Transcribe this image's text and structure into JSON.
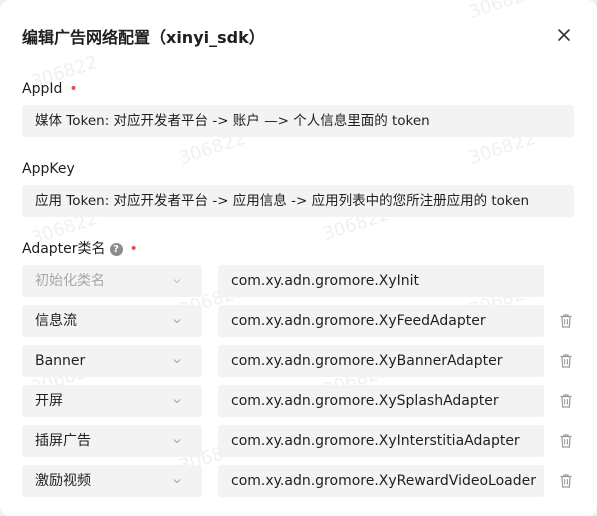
{
  "dialog": {
    "title": "编辑广告网络配置（xinyi_sdk）"
  },
  "fields": {
    "appid": {
      "label": "AppId",
      "required_mark": "•",
      "value": "媒体 Token: 对应开发者平台 -> 账户 —> 个人信息里面的 token"
    },
    "appkey": {
      "label": "AppKey",
      "value": "应用 Token: 对应开发者平台 -> 应用信息 -> 应用列表中的您所注册应用的 token"
    },
    "adapter": {
      "label": "Adapter类名",
      "help_glyph": "?",
      "required_mark": "•",
      "rows": [
        {
          "type": "初始化类名",
          "class_name": "com.xy.adn.gromore.XyInit",
          "disabled": true
        },
        {
          "type": "信息流",
          "class_name": "com.xy.adn.gromore.XyFeedAdapter"
        },
        {
          "type": "Banner",
          "class_name": "com.xy.adn.gromore.XyBannerAdapter"
        },
        {
          "type": "开屏",
          "class_name": "com.xy.adn.gromore.XySplashAdapter"
        },
        {
          "type": "插屏广告",
          "class_name": "com.xy.adn.gromore.XyInterstitiaAdapter"
        },
        {
          "type": "激励视频",
          "class_name": "com.xy.adn.gromore.XyRewardVideoLoader"
        }
      ]
    }
  },
  "watermark": "306822",
  "icons": {
    "close": "close-icon",
    "chevron": "chevron-down-icon",
    "delete": "trash-icon",
    "help": "help-icon"
  },
  "colors": {
    "required": "#e34d59",
    "input_bg": "#f3f3f3",
    "disabled_text": "#a8a8a8"
  }
}
